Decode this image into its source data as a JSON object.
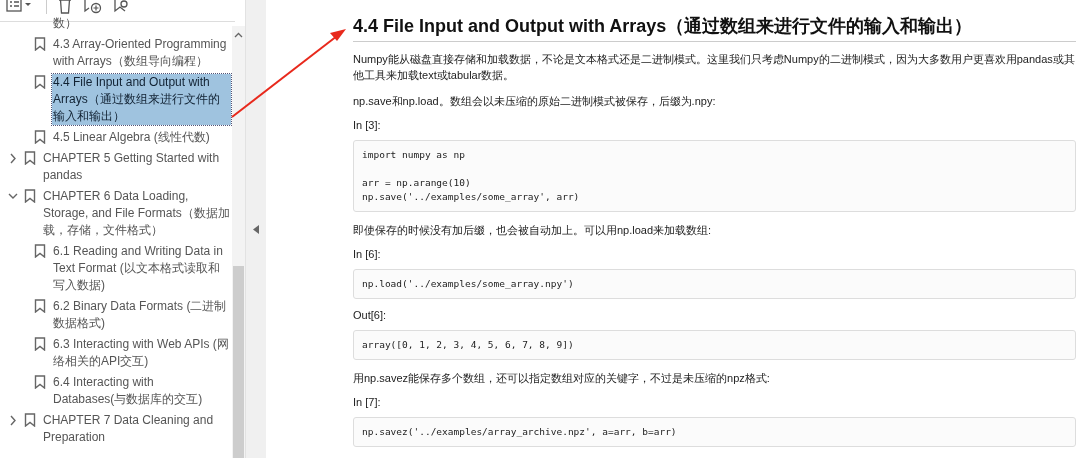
{
  "bookmarks": [
    {
      "children": [
        {
          "kind": "fragment",
          "label": "数）",
          "selected": false
        },
        {
          "kind": "bookmark",
          "label": "4.3 Array-Oriented Programming with Arrays（数组导向编程）",
          "selected": false
        },
        {
          "kind": "bookmark",
          "label": "4.4 File Input and Output with Arrays（通过数组来进行文件的输入和输出）",
          "selected": true
        },
        {
          "kind": "bookmark",
          "label": "4.5 Linear Algebra (线性代数)",
          "selected": false
        }
      ]
    },
    {
      "kind": "bookmark",
      "label": "CHAPTER 5 Getting Started with pandas",
      "expanded": false,
      "selected": false
    },
    {
      "kind": "bookmark",
      "label": "CHAPTER 6 Data Loading, Storage, and File Formats（数据加载，存储，文件格式）",
      "expanded": true,
      "selected": false,
      "children": [
        {
          "kind": "bookmark",
          "label": "6.1 Reading and Writing Data in Text Format (以文本格式读取和写入数据)",
          "selected": false
        },
        {
          "kind": "bookmark",
          "label": "6.2 Binary Data Formats (二进制数据格式)",
          "selected": false
        },
        {
          "kind": "bookmark",
          "label": "6.3 Interacting with Web APIs (网络相关的API交互)",
          "selected": false
        },
        {
          "kind": "bookmark",
          "label": "6.4 Interacting with Databases(与数据库的交互)",
          "selected": false
        }
      ]
    },
    {
      "kind": "bookmark",
      "label": "CHAPTER 7 Data Cleaning and Preparation",
      "expanded": false,
      "selected": false
    }
  ],
  "document": {
    "heading": "4.4 File Input and Output with Arrays（通过数组来进行文件的输入和输出）",
    "blocks": [
      {
        "kind": "text",
        "text": "Numpy能从磁盘直接存储和加载数据，不论是文本格式还是二进制模式。这里我们只考虑Numpy的二进制模式，因为大多数用户更喜欢用pandas或其他工具来加载text或tabular数据。"
      },
      {
        "kind": "text",
        "text": "np.save和np.load。数组会以未压缩的原始二进制模式被保存，后缀为.npy:"
      },
      {
        "kind": "prompt",
        "text": "In [3]:"
      },
      {
        "kind": "code",
        "lines": [
          "import numpy as np\n\narr = np.arange(10)",
          "np.save('../examples/some_array', arr)"
        ]
      },
      {
        "kind": "text",
        "text": "即使保存的时候没有加后缀，也会被自动加上。可以用np.load来加载数组:"
      },
      {
        "kind": "prompt",
        "text": "In [6]:"
      },
      {
        "kind": "code",
        "lines": [
          "np.load('../examples/some_array.npy')"
        ]
      },
      {
        "kind": "prompt",
        "text": "Out[6]:"
      },
      {
        "kind": "code",
        "lines": [
          "array([0, 1, 2, 3, 4, 5, 6, 7, 8, 9])"
        ]
      },
      {
        "kind": "text",
        "text": "用np.savez能保存多个数组，还可以指定数组对应的关键字，不过是未压缩的npz格式:"
      },
      {
        "kind": "prompt",
        "text": "In [7]:"
      },
      {
        "kind": "code",
        "lines": [
          "np.savez('../examples/array_archive.npz', a=arr, b=arr)"
        ]
      }
    ]
  }
}
